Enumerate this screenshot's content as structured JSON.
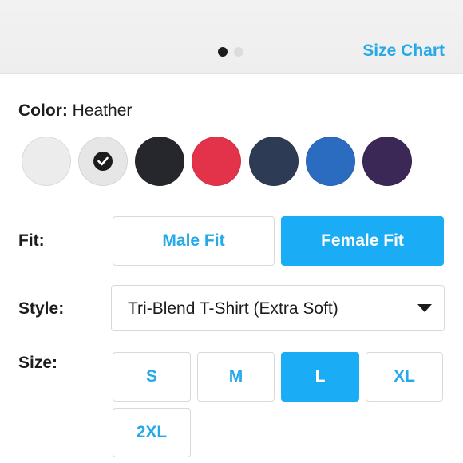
{
  "header": {
    "pager": {
      "total": 2,
      "active": 1
    },
    "size_chart_label": "Size Chart"
  },
  "color": {
    "label": "Color:",
    "selected_name": "Heather",
    "swatches": [
      {
        "color": "#ececec",
        "selected": false
      },
      {
        "color": "#e6e6e6",
        "selected": true
      },
      {
        "color": "#25272c",
        "selected": false
      },
      {
        "color": "#e2334a",
        "selected": false
      },
      {
        "color": "#2e3b54",
        "selected": false
      },
      {
        "color": "#2b6bc0",
        "selected": false
      },
      {
        "color": "#3b2856",
        "selected": false
      }
    ]
  },
  "fit": {
    "label": "Fit:",
    "options": [
      "Male Fit",
      "Female Fit"
    ],
    "selected": "Female Fit"
  },
  "style": {
    "label": "Style:",
    "value": "Tri-Blend T-Shirt (Extra Soft)"
  },
  "size": {
    "label": "Size:",
    "options": [
      "S",
      "M",
      "L",
      "XL",
      "2XL"
    ],
    "selected": "L"
  },
  "colors": {
    "accent": "#26a9e8",
    "selected_bg": "#1aadf5"
  }
}
